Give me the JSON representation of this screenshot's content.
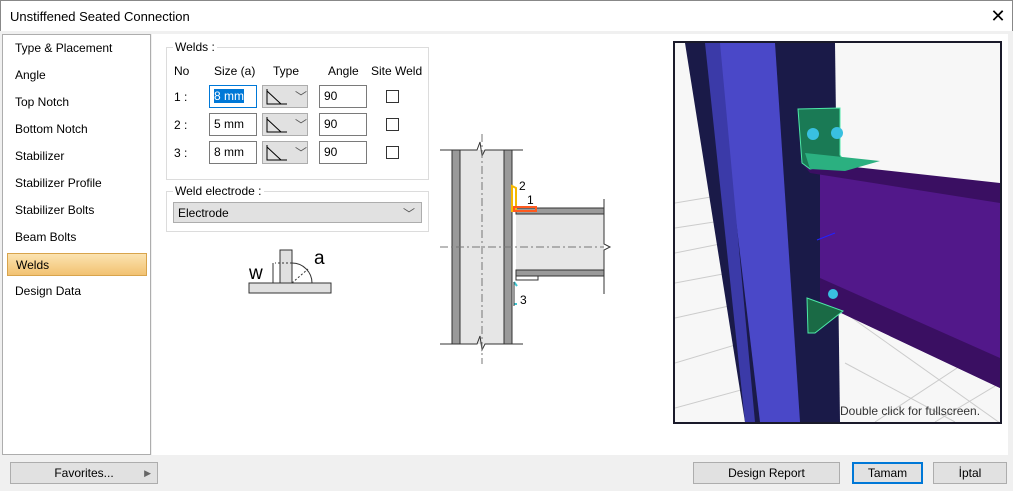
{
  "window": {
    "title": "Unstiffened Seated Connection",
    "close_icon": "close-icon"
  },
  "sidebar": {
    "items": [
      {
        "label": "Type & Placement"
      },
      {
        "label": "Angle"
      },
      {
        "label": "Top Notch"
      },
      {
        "label": "Bottom Notch"
      },
      {
        "label": "Stabilizer"
      },
      {
        "label": "Stabilizer Profile"
      },
      {
        "label": "Stabilizer Bolts"
      },
      {
        "label": "Beam Bolts"
      },
      {
        "label": "Welds",
        "active": true
      },
      {
        "label": "Design Data"
      }
    ]
  },
  "welds": {
    "legend": "Welds :",
    "headers": {
      "no": "No",
      "size": "Size (a)",
      "type": "Type",
      "angle": "Angle",
      "site": "Site Weld"
    },
    "rows": [
      {
        "no": "1 :",
        "size": "8 mm",
        "angle": "90",
        "site": false
      },
      {
        "no": "2 :",
        "size": "5 mm",
        "angle": "90",
        "site": false
      },
      {
        "no": "3 :",
        "size": "8 mm",
        "angle": "90",
        "site": false
      }
    ]
  },
  "electrode": {
    "legend": "Weld electrode :",
    "value": "Electrode"
  },
  "weld_diagram": {
    "w": "w",
    "a": "a"
  },
  "section_labels": {
    "one": "1",
    "two": "2",
    "three": "3"
  },
  "viewer": {
    "hint": "Double click for fullscreen."
  },
  "footer": {
    "favorites": "Favorites...",
    "design_report": "Design Report",
    "ok": "Tamam",
    "cancel": "İptal"
  },
  "colors": {
    "accent": "#0078d7",
    "active_item": "#f5cf86",
    "weld1": "#ff5a1f",
    "weld2": "#f5b800",
    "weld3": "#3ec5d0"
  }
}
